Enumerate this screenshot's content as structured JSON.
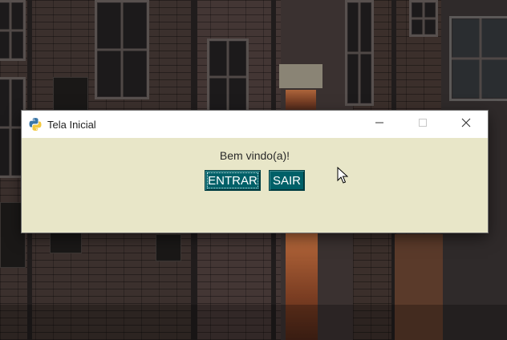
{
  "window": {
    "title": "Tela Inicial",
    "icon": "python-icon",
    "controls": {
      "minimize": "minimize-icon",
      "maximize": "maximize-icon",
      "close": "close-icon"
    }
  },
  "content": {
    "welcome_text": "Bem vindo(a)!",
    "buttons": {
      "enter_label": "ENTRAR",
      "exit_label": "SAIR"
    }
  },
  "colors": {
    "window_bg": "#e8e6c8",
    "button_bg": "#006068",
    "button_text": "#ffffff",
    "titlebar_bg": "#ffffff"
  },
  "background": {
    "description_icon": "street-wallpaper"
  }
}
